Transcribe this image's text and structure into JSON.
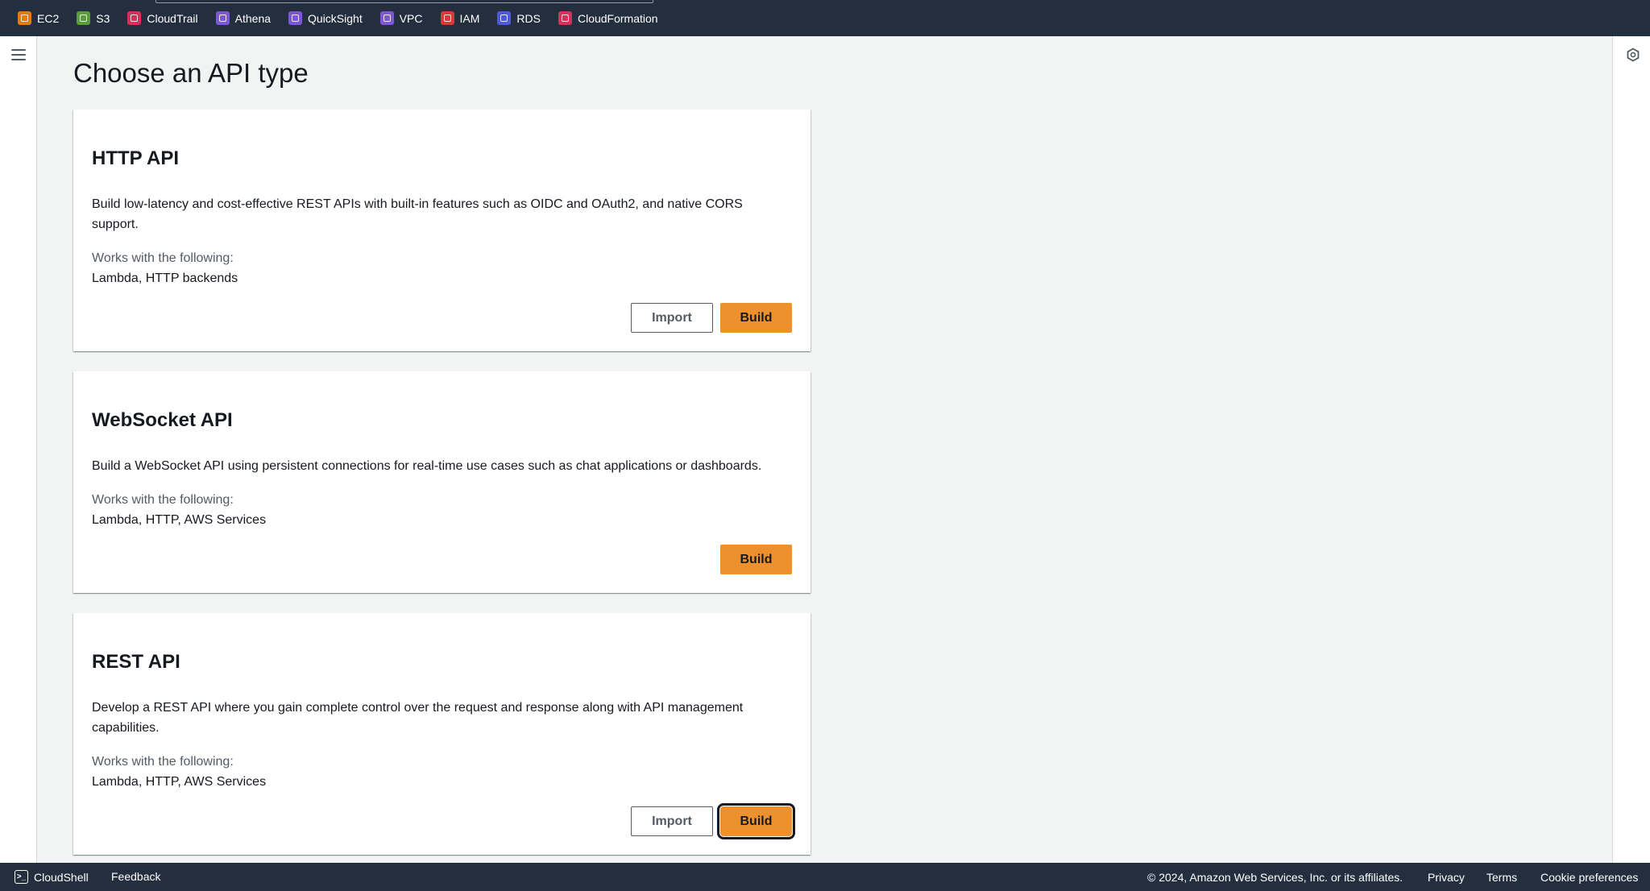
{
  "services": [
    {
      "label": "EC2",
      "color": "#e07c17"
    },
    {
      "label": "S3",
      "color": "#5a9e3b"
    },
    {
      "label": "CloudTrail",
      "color": "#d6315b"
    },
    {
      "label": "Athena",
      "color": "#7d58d6"
    },
    {
      "label": "QuickSight",
      "color": "#7d58d6"
    },
    {
      "label": "VPC",
      "color": "#7d58d6"
    },
    {
      "label": "IAM",
      "color": "#d63a3a"
    },
    {
      "label": "RDS",
      "color": "#4d59d6"
    },
    {
      "label": "CloudFormation",
      "color": "#d6315b"
    }
  ],
  "page": {
    "title": "Choose an API type"
  },
  "cards": [
    {
      "title": "HTTP API",
      "description": "Build low-latency and cost-effective REST APIs with built-in features such as OIDC and OAuth2, and native CORS support.",
      "works_label": "Works with the following:",
      "works_value": "Lambda, HTTP backends",
      "import_label": "Import",
      "build_label": "Build"
    },
    {
      "title": "WebSocket API",
      "description": "Build a WebSocket API using persistent connections for real-time use cases such as chat applications or dashboards.",
      "works_label": "Works with the following:",
      "works_value": "Lambda, HTTP, AWS Services",
      "build_label": "Build"
    },
    {
      "title": "REST API",
      "description": "Develop a REST API where you gain complete control over the request and response along with API management capabilities.",
      "works_label": "Works with the following:",
      "works_value": "Lambda, HTTP, AWS Services",
      "import_label": "Import",
      "build_label": "Build"
    }
  ],
  "footer": {
    "cloudshell": "CloudShell",
    "feedback": "Feedback",
    "copyright": "© 2024, Amazon Web Services, Inc. or its affiliates.",
    "privacy": "Privacy",
    "terms": "Terms",
    "cookies": "Cookie preferences"
  },
  "colors": {
    "header_bg": "#232f3e",
    "primary_button": "#ec912d",
    "page_bg": "#f2f3f3"
  }
}
